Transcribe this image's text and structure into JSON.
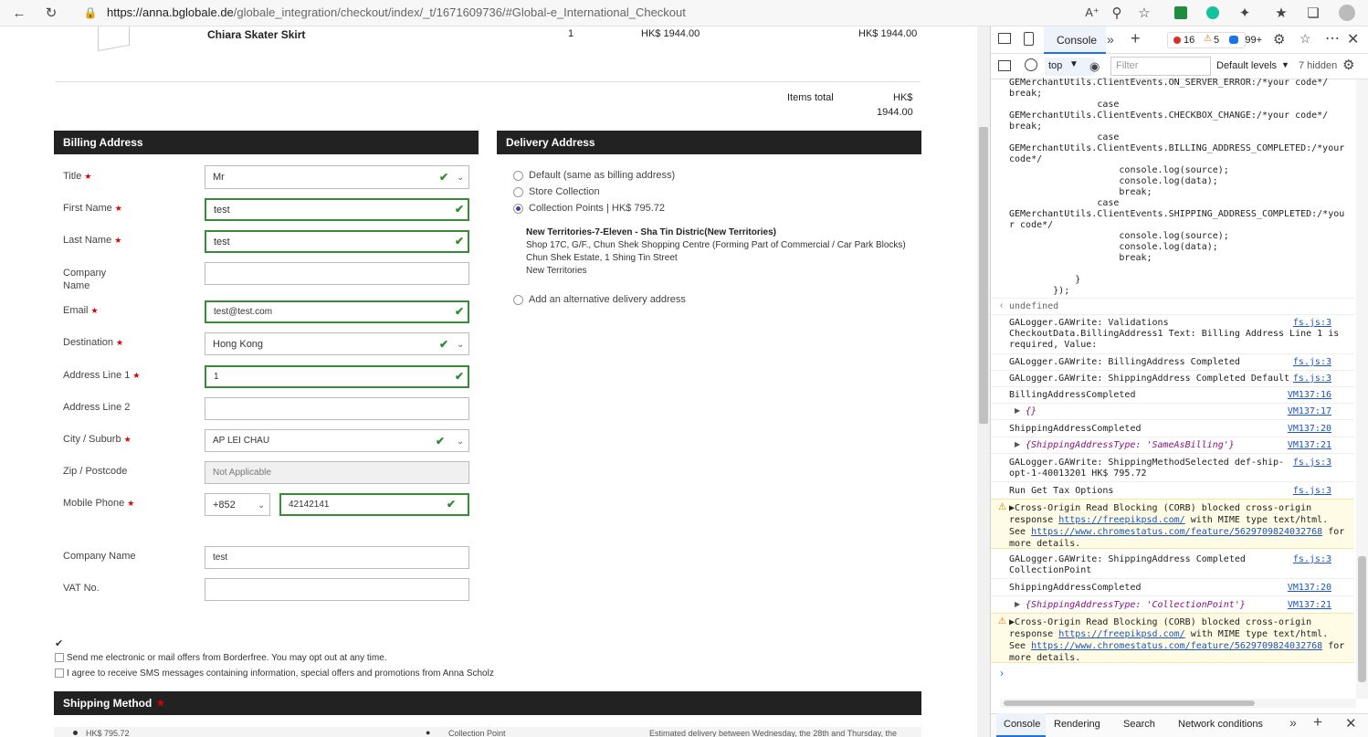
{
  "browser": {
    "url_host": "https://anna.bglobale.de",
    "url_path": "/globale_integration/checkout/index/_t/1671609736/#Global-e_International_Checkout"
  },
  "cart": {
    "product_name": "Chiara Skater Skirt",
    "qty": "1",
    "unit_price": "HK$ 1944.00",
    "total_price": "HK$ 1944.00",
    "items_total_label": "Items total",
    "items_total_currency": "HK$",
    "items_total_value": "1944.00"
  },
  "billing": {
    "header": "Billing Address",
    "title_label": "Title",
    "title_value": "Mr",
    "first_name_label": "First Name",
    "first_name_value": "test",
    "last_name_label": "Last Name",
    "last_name_value": "test",
    "company_label_1": "Company",
    "company_label_2": "Name",
    "email_label": "Email",
    "email_value": "test@test.com",
    "destination_label": "Destination",
    "destination_value": "Hong Kong",
    "address1_label": "Address Line 1",
    "address1_value": "1",
    "address2_label": "Address Line 2",
    "city_label": "City / Suburb",
    "city_value": "AP LEI CHAU",
    "zip_label": "Zip / Postcode",
    "zip_value": "Not Applicable",
    "phone_label": "Mobile Phone",
    "phone_code": "+852",
    "phone_value": "42142141",
    "company_name_label": "Company Name",
    "company_name_value": "test",
    "vat_label": "VAT No."
  },
  "delivery": {
    "header": "Delivery Address",
    "opt_default": "Default (same as billing address)",
    "opt_store": "Store Collection",
    "opt_collection": "Collection Points | HK$ 795.72",
    "point_name": "New Territories-7-Eleven - Sha Tin Distric(New Territories)",
    "point_line1": "Shop 17C, G/F., Chun Shek Shopping Centre (Forming Part of Commercial / Car Park Blocks)",
    "point_line2": "Chun Shek Estate, 1 Shing Tin Street",
    "point_line3": "New Territories",
    "opt_alternative": "Add an alternative delivery address"
  },
  "consent": {
    "offers_text": "Send me electronic or mail offers from Borderfree. You may opt out at any time.",
    "sms_text": "I agree to receive SMS messages containing information, special offers and promotions from Anna Scholz"
  },
  "shipping": {
    "header": "Shipping Method",
    "row_price": "HK$ 795.72",
    "row_type": "Collection Point",
    "row_estimate": "Estimated delivery between Wednesday, the 28th and Thursday, the"
  },
  "devtools": {
    "tab_console": "Console",
    "errors": "16",
    "warnings": "5",
    "messages": "99+",
    "context": "top",
    "filter_placeholder": "Filter",
    "levels": "Default levels",
    "hidden": "7 hidden",
    "code_block": "GEMerchantUtils.ClientEvents.ON_SERVER_ERROR:/*your code*/\nbreak;\n                case\nGEMerchantUtils.ClientEvents.CHECKBOX_CHANGE:/*your code*/\nbreak;\n                case\nGEMerchantUtils.ClientEvents.BILLING_ADDRESS_COMPLETED:/*your\ncode*/\n                    console.log(source);\n                    console.log(data);\n                    break;\n                case\nGEMerchantUtils.ClientEvents.SHIPPING_ADDRESS_COMPLETED:/*you\nr code*/\n                    console.log(source);\n                    console.log(data);\n                    break;\n\n            }\n        });",
    "undefined": "undefined",
    "log1": "GALogger.GAWrite: Validations\nCheckoutData.BillingAddress1 Text: Billing Address Line 1 is\nrequired, Value:",
    "log1_src": "fs.js:3",
    "log2": "GALogger.GAWrite: BillingAddress Completed",
    "log2_src": "fs.js:3",
    "log3": "GALogger.GAWrite: ShippingAddress Completed Default",
    "log3_src": "fs.js:3",
    "log4": "BillingAddressCompleted",
    "log4_src": "VM137:16",
    "log5": "{}",
    "log5_src": "VM137:17",
    "log6": "ShippingAddressCompleted",
    "log6_src": "VM137:20",
    "log7": "{ShippingAddressType: 'SameAsBilling'}",
    "log7_src": "VM137:21",
    "log8": "GALogger.GAWrite: ShippingMethodSelected def-ship-\nopt-1-40013201 HK$ 795.72",
    "log8_src": "fs.js:3",
    "log9": "Run Get Tax Options",
    "log9_src": "fs.js:3",
    "warn_a": "Cross-Origin Read Blocking (CORB) blocked cross-origin",
    "warn_b": "response",
    "warn_url1": "https://freepikpsd.com/",
    "warn_c": " with MIME type text/html.",
    "warn_d": "See ",
    "warn_url2": "https://www.chromestatus.com/feature/5629709824032768",
    "warn_e": " for",
    "warn_f": "more details.",
    "log10": "GALogger.GAWrite: ShippingAddress Completed\nCollectionPoint",
    "log10_src": "fs.js:3",
    "log11": "ShippingAddressCompleted",
    "log11_src": "VM137:20",
    "log12": "{ShippingAddressType: 'CollectionPoint'}",
    "log12_src": "VM137:21",
    "drawer_console": "Console",
    "drawer_rendering": "Rendering",
    "drawer_search": "Search",
    "drawer_network": "Network conditions"
  }
}
